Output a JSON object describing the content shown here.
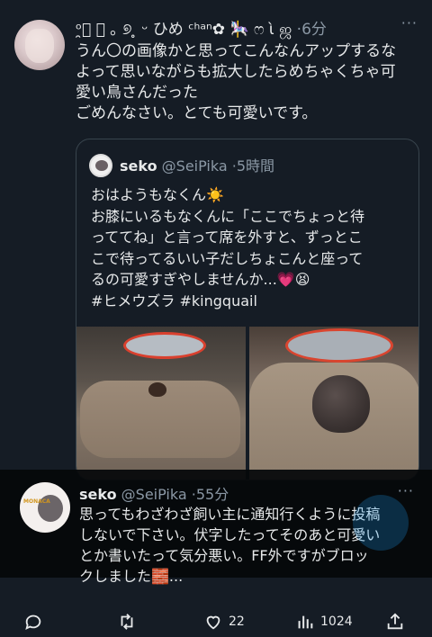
{
  "post": {
    "author_display": "ᵒ̯᪲ ︶ ｡ ୭ ̥ ᵕ ひめ ᶜʰᵃⁿ✿ 🎠 ෆ ὶ ஜ",
    "time": "6分",
    "text_lines": [
      "うん〇の画像かと思ってこんなんアップするな",
      "よって思いながらも拡大したらめちゃくちゃ可",
      "愛い鳥さんだった",
      "ごめんなさい。とても可愛いです。"
    ]
  },
  "quoted": {
    "name": "seko",
    "handle": "@SeiPika",
    "time": "5時間",
    "text_lines": [
      "おはようもなくん☀️",
      "お膝にいるもなくんに「ここでちょっと待",
      "っててね」と言って席を外すと、ずっとこ",
      "こで待ってるいい子だしちょこんと座って",
      "るの可愛すぎやしませんか...💗😫",
      "#ヒメウズラ #kingquail"
    ]
  },
  "reply_overlay": {
    "name": "seko",
    "handle": "@SeiPika",
    "time": "55分",
    "avatar_label": "MONACA",
    "text_lines": [
      "思ってもわざわざ飼い主に通知行くように投稿",
      "しないで下さい。伏字したってそのあと可愛い",
      "とか書いたって気分悪い。FF外ですがブロッ",
      "クしました🧱..."
    ]
  },
  "actions": {
    "reply_icon": "reply-icon",
    "retweet_icon": "retweet-icon",
    "like_icon": "heart-icon",
    "like_count": "22",
    "views_icon": "views-icon",
    "views_count": "1024",
    "share_icon": "share-icon"
  },
  "colors": {
    "background": "#151c25",
    "text": "#e7e9ea",
    "muted": "#8b98a5",
    "border": "#38444d"
  }
}
